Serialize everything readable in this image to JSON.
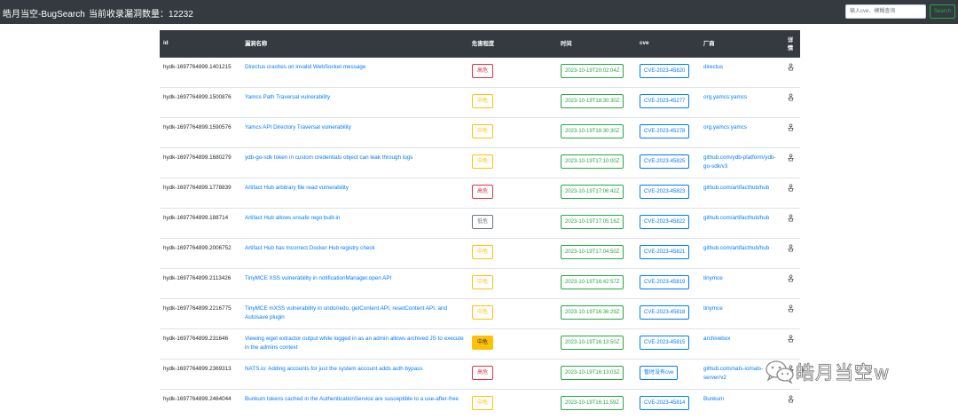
{
  "navbar": {
    "brand": "皓月当空-BugSearch",
    "count_text": "当前收录漏洞数量：12232",
    "search_placeholder": "输入cve、模糊查询",
    "search_button": "Search"
  },
  "table": {
    "headers": {
      "id": "id",
      "name": "漏洞名称",
      "severity": "危害程度",
      "time": "时间",
      "cve": "cve",
      "vendor": "厂商",
      "detail_line1": "详",
      "detail_line2": "情"
    },
    "rows": [
      {
        "id": "hydk-1697764899.1401215",
        "name": "Directus crashes on invalid WebSocket message",
        "severity": "高危",
        "sev_class": "high",
        "time": "2023-10-19T20:02:04Z",
        "cve": "CVE-2023-45820",
        "vendor": "directus"
      },
      {
        "id": "hydk-1697764899.1500876",
        "name": "Yamcs Path Traversal vulnerability",
        "severity": "中危",
        "sev_class": "mid",
        "time": "2023-10-19T18:30:30Z",
        "cve": "CVE-2023-45277",
        "vendor": "org.yamcs:yamcs"
      },
      {
        "id": "hydk-1697764899.1590576",
        "name": "Yamcs API Directory Traversal vulnerability",
        "severity": "中危",
        "sev_class": "mid",
        "time": "2023-10-19T18:30:30Z",
        "cve": "CVE-2023-45278",
        "vendor": "org.yamcs:yamcs"
      },
      {
        "id": "hydk-1697764899.1680279",
        "name": "ydb-go-sdk token in custom credentials object can leak through logs",
        "severity": "中危",
        "sev_class": "mid",
        "time": "2023-10-19T17:10:00Z",
        "cve": "CVE-2023-45825",
        "vendor": "github.com/ydb-platform/ydb-go-sdk/v3"
      },
      {
        "id": "hydk-1697764899.1778839",
        "name": "Artifact Hub arbitrary file read vulnerability",
        "severity": "高危",
        "sev_class": "high",
        "time": "2023-10-19T17:06:42Z",
        "cve": "CVE-2023-45823",
        "vendor": "github.com/artifacthub/hub"
      },
      {
        "id": "hydk-1697764899.188714",
        "name": "Artifact Hub allows unsafe rego built-in",
        "severity": "低危",
        "sev_class": "low",
        "time": "2023-10-19T17:05:16Z",
        "cve": "CVE-2023-45822",
        "vendor": "github.com/artifacthub/hub"
      },
      {
        "id": "hydk-1697764899.2006752",
        "name": "Artifact Hub has Incorrect Docker Hub registry check",
        "severity": "中危",
        "sev_class": "mid",
        "time": "2023-10-19T17:04:50Z",
        "cve": "CVE-2023-45821",
        "vendor": "github.com/artifacthub/hub"
      },
      {
        "id": "hydk-1697764899.2113426",
        "name": "TinyMCE XSS vulnerability in notificationManager.open API",
        "severity": "中危",
        "sev_class": "mid",
        "time": "2023-10-19T16:42:57Z",
        "cve": "CVE-2023-45819",
        "vendor": "tinymce"
      },
      {
        "id": "hydk-1697764899.2216775",
        "name": "TinyMCE mXSS vulnerability in undo/redo, getContent API, resetContent API, and Autosave plugin",
        "severity": "中危",
        "sev_class": "mid",
        "time": "2023-10-19T16:36:29Z",
        "cve": "CVE-2023-45818",
        "vendor": "tinymce"
      },
      {
        "id": "hydk-1697764899.231646",
        "name": "Viewing wget extractor output while logged in as an admin allows archived JS to execute in the admins context",
        "severity": "中危",
        "sev_class": "filled",
        "time": "2023-10-19T16:13:50Z",
        "cve": "CVE-2023-45815",
        "vendor": "archivebox"
      },
      {
        "id": "hydk-1697764899.2369313",
        "name": "NATS.io: Adding accounts for just the system account adds auth bypass",
        "severity": "高危",
        "sev_class": "high",
        "time": "2023-10-19T16:13:03Z",
        "cve": "暂时没有cve",
        "vendor": "github.com/nats-io/nats-server/v2"
      },
      {
        "id": "hydk-1697764899.2464044",
        "name": "Bunkum tokens cached in the AuthenticationService are susceptible to a use-after-free",
        "severity": "中危",
        "sev_class": "mid",
        "time": "2023-10-19T16:11:59Z",
        "cve": "CVE-2023-45814",
        "vendor": "Bunkum"
      }
    ]
  },
  "watermark": {
    "text": "皓月当空w",
    "icon": "wechat-logo-icon"
  }
}
